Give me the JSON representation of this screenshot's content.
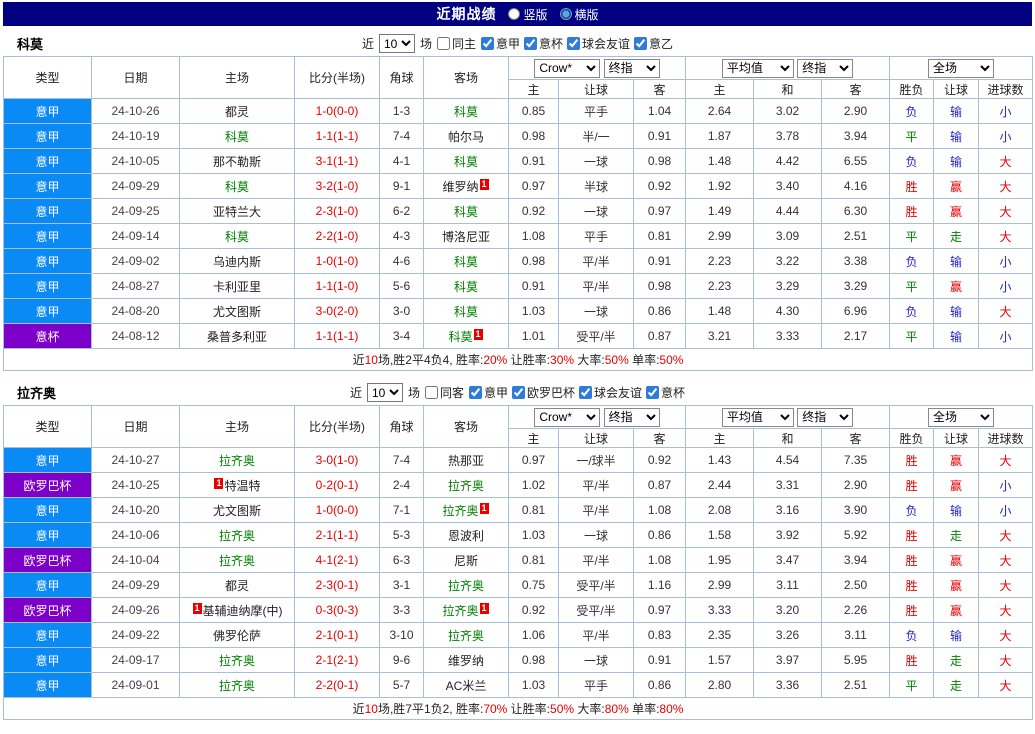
{
  "topbar": {
    "title": "近期战绩",
    "options": [
      {
        "label": "竖版",
        "selected": false
      },
      {
        "label": "横版",
        "selected": true
      }
    ]
  },
  "table_header": {
    "cols": [
      "类型",
      "日期",
      "主场",
      "比分(半场)",
      "角球",
      "客场"
    ],
    "odds_group": {
      "select1": "Crow*",
      "select2": "终指",
      "subcols": [
        "主",
        "让球",
        "客"
      ]
    },
    "avg_group": {
      "select1": "平均值",
      "select2": "终指",
      "subcols": [
        "主",
        "和",
        "客"
      ]
    },
    "result_group": {
      "select": "全场",
      "subcols": [
        "胜负",
        "让球",
        "进球数"
      ]
    }
  },
  "colors": {
    "topbar_bg": "#000080",
    "border": "#a9bed8",
    "league_blue": "#0a8af5",
    "league_purple": "#7d00c8",
    "team_green": "#008000",
    "score_red": "#e60000",
    "res_red": "#e60000",
    "res_green": "#008000",
    "res_blue": "#1e1ecd",
    "badge_bg": "#e60000",
    "badge_fg": "#ffffff"
  },
  "result_colors": {
    "胜": "red",
    "赢": "red",
    "大": "red",
    "平": "green",
    "走": "green",
    "负": "blue",
    "输": "blue",
    "小": "blue"
  },
  "sections": [
    {
      "team": "科莫",
      "filter": {
        "near_label": "近",
        "count": "10",
        "games_label": "场",
        "same": {
          "label": "同主",
          "checked": false
        },
        "leagues": [
          {
            "label": "意甲",
            "checked": true
          },
          {
            "label": "意杯",
            "checked": true
          },
          {
            "label": "球会友谊",
            "checked": true
          },
          {
            "label": "意乙",
            "checked": true
          }
        ]
      },
      "rows": [
        {
          "league": "意甲",
          "lcolor": "blue",
          "date": "24-10-26",
          "home": {
            "name": "都灵"
          },
          "score": "1-0(0-0)",
          "corner": "1-3",
          "away": {
            "name": "科莫",
            "green": true
          },
          "odds": [
            "0.85",
            "平手",
            "1.04"
          ],
          "avg": [
            "2.64",
            "3.02",
            "2.90"
          ],
          "results": [
            "负",
            "输",
            "小"
          ]
        },
        {
          "league": "意甲",
          "lcolor": "blue",
          "date": "24-10-19",
          "home": {
            "name": "科莫",
            "green": true
          },
          "score": "1-1(1-1)",
          "corner": "7-4",
          "away": {
            "name": "帕尔马"
          },
          "odds": [
            "0.98",
            "半/一",
            "0.91"
          ],
          "avg": [
            "1.87",
            "3.78",
            "3.94"
          ],
          "results": [
            "平",
            "输",
            "小"
          ]
        },
        {
          "league": "意甲",
          "lcolor": "blue",
          "date": "24-10-05",
          "home": {
            "name": "那不勒斯"
          },
          "score": "3-1(1-1)",
          "corner": "4-1",
          "away": {
            "name": "科莫",
            "green": true
          },
          "odds": [
            "0.91",
            "一球",
            "0.98"
          ],
          "avg": [
            "1.48",
            "4.42",
            "6.55"
          ],
          "results": [
            "负",
            "输",
            "大"
          ]
        },
        {
          "league": "意甲",
          "lcolor": "blue",
          "date": "24-09-29",
          "home": {
            "name": "科莫",
            "green": true
          },
          "score": "3-2(1-0)",
          "corner": "9-1",
          "away": {
            "name": "维罗纳",
            "badge_after": "1"
          },
          "odds": [
            "0.97",
            "半球",
            "0.92"
          ],
          "avg": [
            "1.92",
            "3.40",
            "4.16"
          ],
          "results": [
            "胜",
            "赢",
            "大"
          ]
        },
        {
          "league": "意甲",
          "lcolor": "blue",
          "date": "24-09-25",
          "home": {
            "name": "亚特兰大"
          },
          "score": "2-3(1-0)",
          "corner": "6-2",
          "away": {
            "name": "科莫",
            "green": true
          },
          "odds": [
            "0.92",
            "一球",
            "0.97"
          ],
          "avg": [
            "1.49",
            "4.44",
            "6.30"
          ],
          "results": [
            "胜",
            "赢",
            "大"
          ]
        },
        {
          "league": "意甲",
          "lcolor": "blue",
          "date": "24-09-14",
          "home": {
            "name": "科莫",
            "green": true
          },
          "score": "2-2(1-0)",
          "corner": "4-3",
          "away": {
            "name": "博洛尼亚"
          },
          "odds": [
            "1.08",
            "平手",
            "0.81"
          ],
          "avg": [
            "2.99",
            "3.09",
            "2.51"
          ],
          "results": [
            "平",
            "走",
            "大"
          ]
        },
        {
          "league": "意甲",
          "lcolor": "blue",
          "date": "24-09-02",
          "home": {
            "name": "乌迪内斯"
          },
          "score": "1-0(1-0)",
          "corner": "4-6",
          "away": {
            "name": "科莫",
            "green": true
          },
          "odds": [
            "0.98",
            "平/半",
            "0.91"
          ],
          "avg": [
            "2.23",
            "3.22",
            "3.38"
          ],
          "results": [
            "负",
            "输",
            "小"
          ]
        },
        {
          "league": "意甲",
          "lcolor": "blue",
          "date": "24-08-27",
          "home": {
            "name": "卡利亚里"
          },
          "score": "1-1(1-0)",
          "corner": "5-6",
          "away": {
            "name": "科莫",
            "green": true
          },
          "odds": [
            "0.91",
            "平/半",
            "0.98"
          ],
          "avg": [
            "2.23",
            "3.29",
            "3.29"
          ],
          "results": [
            "平",
            "赢",
            "小"
          ]
        },
        {
          "league": "意甲",
          "lcolor": "blue",
          "date": "24-08-20",
          "home": {
            "name": "尤文图斯"
          },
          "score": "3-0(2-0)",
          "corner": "3-0",
          "away": {
            "name": "科莫",
            "green": true
          },
          "odds": [
            "1.03",
            "一球",
            "0.86"
          ],
          "avg": [
            "1.48",
            "4.30",
            "6.96"
          ],
          "results": [
            "负",
            "输",
            "大"
          ]
        },
        {
          "league": "意杯",
          "lcolor": "purple",
          "date": "24-08-12",
          "home": {
            "name": "桑普多利亚"
          },
          "score": "1-1(1-1)",
          "corner": "3-4",
          "away": {
            "name": "科莫",
            "green": true,
            "badge_after": "1"
          },
          "odds": [
            "1.01",
            "受平/半",
            "0.87"
          ],
          "avg": [
            "3.21",
            "3.33",
            "2.17"
          ],
          "results": [
            "平",
            "输",
            "小"
          ]
        }
      ],
      "summary": [
        {
          "t": "近",
          "red": false
        },
        {
          "t": "10",
          "red": true
        },
        {
          "t": "场,胜2平4负4, 胜率:",
          "red": false
        },
        {
          "t": "20%",
          "red": true
        },
        {
          "t": " 让胜率:",
          "red": false
        },
        {
          "t": "30%",
          "red": true
        },
        {
          "t": " 大率:",
          "red": false
        },
        {
          "t": "50%",
          "red": true
        },
        {
          "t": " 单率:",
          "red": false
        },
        {
          "t": "50%",
          "red": true
        }
      ]
    },
    {
      "team": "拉齐奥",
      "filter": {
        "near_label": "近",
        "count": "10",
        "games_label": "场",
        "same": {
          "label": "同客",
          "checked": false
        },
        "leagues": [
          {
            "label": "意甲",
            "checked": true
          },
          {
            "label": "欧罗巴杯",
            "checked": true
          },
          {
            "label": "球会友谊",
            "checked": true
          },
          {
            "label": "意杯",
            "checked": true
          }
        ]
      },
      "rows": [
        {
          "league": "意甲",
          "lcolor": "blue",
          "date": "24-10-27",
          "home": {
            "name": "拉齐奥",
            "green": true
          },
          "score": "3-0(1-0)",
          "corner": "7-4",
          "away": {
            "name": "热那亚"
          },
          "odds": [
            "0.97",
            "一/球半",
            "0.92"
          ],
          "avg": [
            "1.43",
            "4.54",
            "7.35"
          ],
          "results": [
            "胜",
            "赢",
            "大"
          ]
        },
        {
          "league": "欧罗巴杯",
          "lcolor": "purple",
          "date": "24-10-25",
          "home": {
            "name": "特温特",
            "badge_before": "1"
          },
          "score": "0-2(0-1)",
          "corner": "2-4",
          "away": {
            "name": "拉齐奥",
            "green": true
          },
          "odds": [
            "1.02",
            "平/半",
            "0.87"
          ],
          "avg": [
            "2.44",
            "3.31",
            "2.90"
          ],
          "results": [
            "胜",
            "赢",
            "小"
          ]
        },
        {
          "league": "意甲",
          "lcolor": "blue",
          "date": "24-10-20",
          "home": {
            "name": "尤文图斯"
          },
          "score": "1-0(0-0)",
          "corner": "7-1",
          "away": {
            "name": "拉齐奥",
            "green": true,
            "badge_after": "1"
          },
          "odds": [
            "0.81",
            "平/半",
            "1.08"
          ],
          "avg": [
            "2.08",
            "3.16",
            "3.90"
          ],
          "results": [
            "负",
            "输",
            "小"
          ]
        },
        {
          "league": "意甲",
          "lcolor": "blue",
          "date": "24-10-06",
          "home": {
            "name": "拉齐奥",
            "green": true
          },
          "score": "2-1(1-1)",
          "corner": "5-3",
          "away": {
            "name": "恩波利"
          },
          "odds": [
            "1.03",
            "一球",
            "0.86"
          ],
          "avg": [
            "1.58",
            "3.92",
            "5.92"
          ],
          "results": [
            "胜",
            "走",
            "大"
          ]
        },
        {
          "league": "欧罗巴杯",
          "lcolor": "purple",
          "date": "24-10-04",
          "home": {
            "name": "拉齐奥",
            "green": true
          },
          "score": "4-1(2-1)",
          "corner": "6-3",
          "away": {
            "name": "尼斯"
          },
          "odds": [
            "0.81",
            "平/半",
            "1.08"
          ],
          "avg": [
            "1.95",
            "3.47",
            "3.94"
          ],
          "results": [
            "胜",
            "赢",
            "大"
          ]
        },
        {
          "league": "意甲",
          "lcolor": "blue",
          "date": "24-09-29",
          "home": {
            "name": "都灵"
          },
          "score": "2-3(0-1)",
          "corner": "3-1",
          "away": {
            "name": "拉齐奥",
            "green": true
          },
          "odds": [
            "0.75",
            "受平/半",
            "1.16"
          ],
          "avg": [
            "2.99",
            "3.11",
            "2.50"
          ],
          "results": [
            "胜",
            "赢",
            "大"
          ]
        },
        {
          "league": "欧罗巴杯",
          "lcolor": "purple",
          "date": "24-09-26",
          "home": {
            "name": "基辅迪纳摩(中)",
            "badge_before": "1"
          },
          "score": "0-3(0-3)",
          "corner": "3-3",
          "away": {
            "name": "拉齐奥",
            "green": true,
            "badge_after": "1"
          },
          "odds": [
            "0.92",
            "受平/半",
            "0.97"
          ],
          "avg": [
            "3.33",
            "3.20",
            "2.26"
          ],
          "results": [
            "胜",
            "赢",
            "大"
          ]
        },
        {
          "league": "意甲",
          "lcolor": "blue",
          "date": "24-09-22",
          "home": {
            "name": "佛罗伦萨"
          },
          "score": "2-1(0-1)",
          "corner": "3-10",
          "away": {
            "name": "拉齐奥",
            "green": true
          },
          "odds": [
            "1.06",
            "平/半",
            "0.83"
          ],
          "avg": [
            "2.35",
            "3.26",
            "3.11"
          ],
          "results": [
            "负",
            "输",
            "大"
          ]
        },
        {
          "league": "意甲",
          "lcolor": "blue",
          "date": "24-09-17",
          "home": {
            "name": "拉齐奥",
            "green": true
          },
          "score": "2-1(2-1)",
          "corner": "9-6",
          "away": {
            "name": "维罗纳"
          },
          "odds": [
            "0.98",
            "一球",
            "0.91"
          ],
          "avg": [
            "1.57",
            "3.97",
            "5.95"
          ],
          "results": [
            "胜",
            "走",
            "大"
          ]
        },
        {
          "league": "意甲",
          "lcolor": "blue",
          "date": "24-09-01",
          "home": {
            "name": "拉齐奥",
            "green": true
          },
          "score": "2-2(0-1)",
          "corner": "5-7",
          "away": {
            "name": "AC米兰"
          },
          "odds": [
            "1.03",
            "平手",
            "0.86"
          ],
          "avg": [
            "2.80",
            "3.36",
            "2.51"
          ],
          "results": [
            "平",
            "走",
            "大"
          ]
        }
      ],
      "summary": [
        {
          "t": "近",
          "red": false
        },
        {
          "t": "10",
          "red": true
        },
        {
          "t": "场,胜7平1负2, 胜率:",
          "red": false
        },
        {
          "t": "70%",
          "red": true
        },
        {
          "t": " 让胜率:",
          "red": false
        },
        {
          "t": "50%",
          "red": true
        },
        {
          "t": " 大率:",
          "red": false
        },
        {
          "t": "80%",
          "red": true
        },
        {
          "t": " 单率:",
          "red": false
        },
        {
          "t": "80%",
          "red": true
        }
      ]
    }
  ]
}
